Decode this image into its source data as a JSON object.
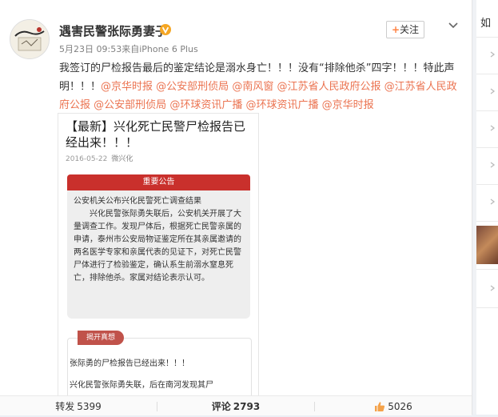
{
  "post": {
    "username": "遇害民警张际勇妻子",
    "meta": "5月23日 09:53来自iPhone 6 Plus",
    "follow_label": "关注",
    "text_main": "我签订的尸检报告最后的鉴定结论是溺水身亡！！！没有“排除他杀”四字！！！特此声明！！！",
    "mentions": [
      "@京华时报",
      "@公安部刑侦局",
      "@南风窗",
      "@江苏省人民政府公报",
      "@江苏省人民政府公报",
      "@公安部刑侦局",
      "@环球资讯广播",
      "@环球资讯广播",
      "@京华时报"
    ]
  },
  "article": {
    "title": "【最新】兴化死亡民警尸检报告已经出来！！！",
    "date": "2016-05-22",
    "source": "微兴化",
    "notice_header": "重要公告",
    "notice_p1": "公安机关公布兴化民警死亡调查结果",
    "notice_p2": "兴化民警张际勇失联后，公安机关开展了大量调查工作。发现尸体后，根据死亡民警亲属的申请，泰州市公安局物证鉴定所在其亲属邀请的两名医学专家和亲属代表的见证下，对死亡民警尸体进行了检验鉴定，确认系生前溺水窒息死亡，排除他杀。家属对结论表示认可。",
    "truth_label": "揭开真想",
    "truth_line1": "张际勇的尸检报告已经出来！！！",
    "truth_line2": "兴化民警张际勇失联，后在南河发现其尸"
  },
  "footer": {
    "repost_label": "转发",
    "repost_count": "5399",
    "comment_label": "评论",
    "comment_count": "2793",
    "like_count": "5026"
  },
  "sidebar": {
    "title": "如"
  },
  "colors": {
    "accent_link": "#eb7350",
    "notice_red": "#c9302c",
    "follow_plus": "#ff8140",
    "verified_badge": "#f5a623"
  },
  "icons": {
    "badge": "verified-v-icon",
    "chevron": "chevron-down-icon",
    "like": "thumbs-up-icon"
  }
}
